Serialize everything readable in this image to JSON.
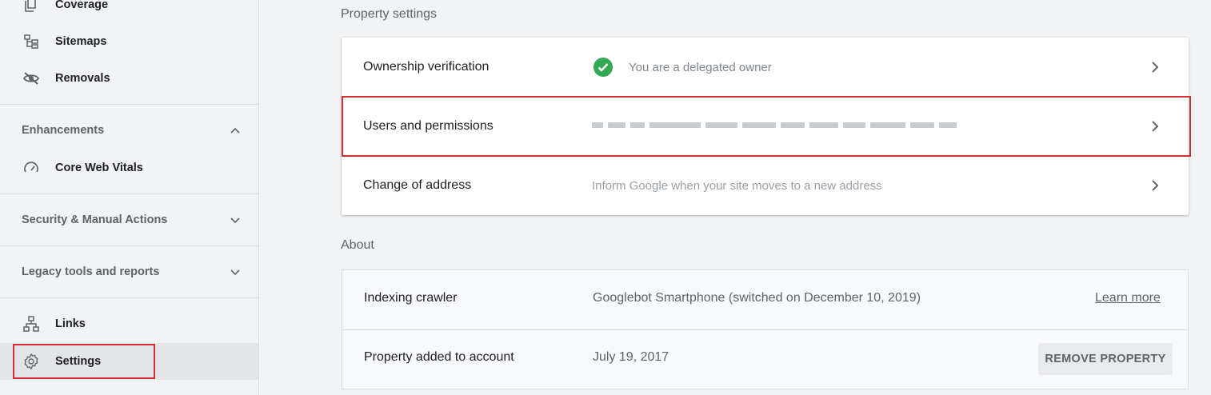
{
  "sidebar": {
    "items_top": [
      {
        "label": "Coverage",
        "icon": "coverage-icon"
      },
      {
        "label": "Sitemaps",
        "icon": "sitemaps-icon"
      },
      {
        "label": "Removals",
        "icon": "removals-icon"
      }
    ],
    "enhancements": {
      "label": "Enhancements",
      "expanded": true
    },
    "core_web_vitals": {
      "label": "Core Web Vitals",
      "icon": "gauge-icon"
    },
    "security": {
      "label": "Security & Manual Actions",
      "expanded": false
    },
    "legacy": {
      "label": "Legacy tools and reports",
      "expanded": false
    },
    "links": {
      "label": "Links",
      "icon": "links-icon"
    },
    "settings": {
      "label": "Settings",
      "icon": "gear-icon",
      "active": true
    }
  },
  "main": {
    "property_settings_heading": "Property settings",
    "settings_rows": [
      {
        "label": "Ownership verification",
        "value": "You are a delegated owner"
      },
      {
        "label": "Users and permissions",
        "value": ""
      },
      {
        "label": "Change of address",
        "value": "Inform Google when your site moves to a new address"
      }
    ],
    "about_heading": "About",
    "about_rows": [
      {
        "label": "Indexing crawler",
        "value": "Googlebot Smartphone (switched on December 10, 2019)",
        "action": "Learn more"
      },
      {
        "label": "Property added to account",
        "value": "July 19, 2017",
        "action": "REMOVE PROPERTY"
      }
    ]
  },
  "colors": {
    "highlight_box": "#d32f2f",
    "verified_green": "#34a853"
  }
}
